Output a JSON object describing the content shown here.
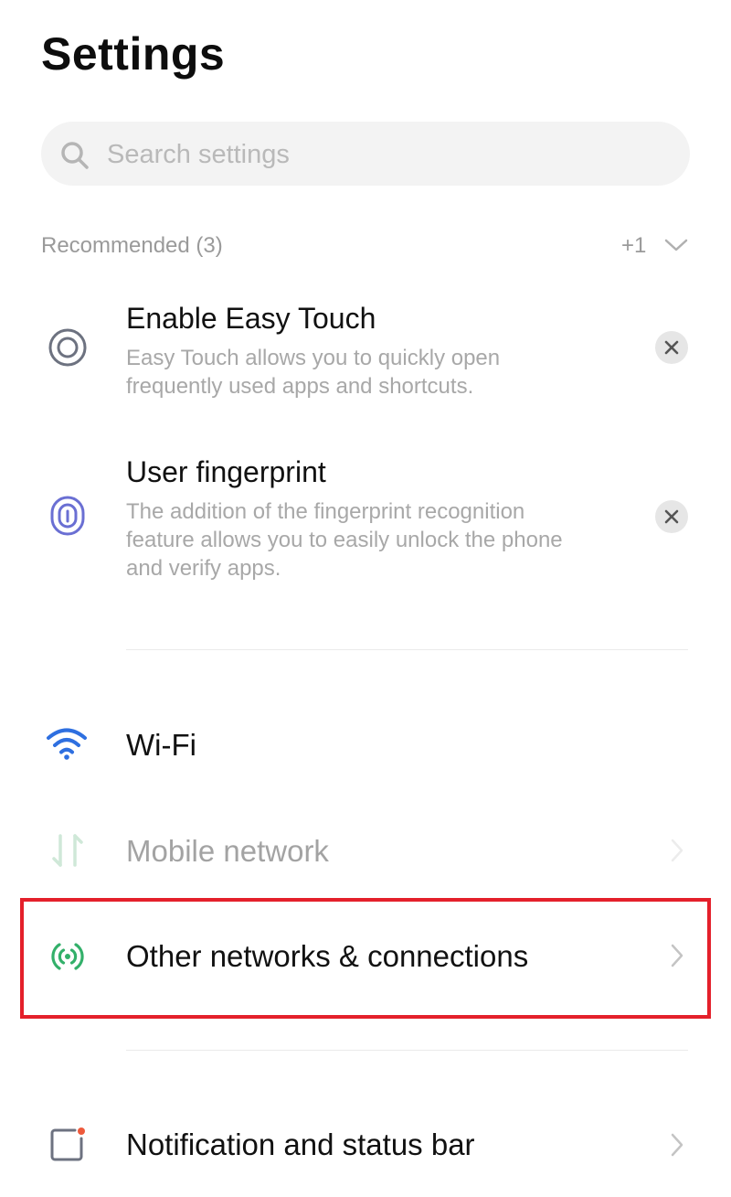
{
  "header": {
    "title": "Settings"
  },
  "search": {
    "placeholder": "Search settings"
  },
  "recommended": {
    "label": "Recommended (3)",
    "more_count": "+1",
    "items": [
      {
        "icon": "easy-touch-icon",
        "title": "Enable Easy Touch",
        "desc_line1": "Easy Touch allows you to quickly open",
        "desc_line2": "frequently used apps and shortcuts."
      },
      {
        "icon": "fingerprint-icon",
        "title": "User fingerprint",
        "desc_line1": "The addition of the fingerprint recognition",
        "desc_line2": "feature allows you to easily unlock the phone",
        "desc_line3": "and verify apps."
      }
    ]
  },
  "settings": [
    {
      "icon": "wifi-icon",
      "label": "Wi-Fi",
      "enabled": true
    },
    {
      "icon": "mobile-network-icon",
      "label": "Mobile network",
      "enabled": false
    },
    {
      "icon": "hotspot-icon",
      "label": "Other networks & connections",
      "enabled": true,
      "highlighted": true
    },
    {
      "icon": "notification-icon",
      "label": "Notification and status bar",
      "enabled": true
    }
  ],
  "colors": {
    "highlight_border": "#e4202b",
    "wifi": "#2e6fe0",
    "hotspot": "#33b06a",
    "fingerprint": "#6a6fd3",
    "notification_dot": "#ee5a3c"
  }
}
